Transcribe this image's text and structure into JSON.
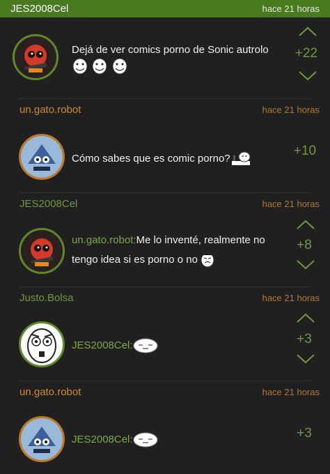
{
  "top": {
    "user": "JES2008Cel",
    "time": "hace 21 horas"
  },
  "comments": [
    {
      "user": "JES2008Cel",
      "time": "hace 21 horas",
      "text": "Dejá de ver comics porno de Sonic autrolo",
      "score": "+22",
      "mention": ""
    },
    {
      "user": "un.gato.robot",
      "time": "hace 21 horas",
      "text": "Cómo sabes que es comic porno?",
      "score": "+10",
      "mention": ""
    },
    {
      "user": "JES2008Cel",
      "time": "hace 21 horas",
      "mention": "un.gato.robot:",
      "text": "Me lo inventé, realmente no",
      "text2": "tengo idea si es porno o no",
      "score": "+8"
    },
    {
      "user": "Justo.Bolsa",
      "time": "hace 21 horas",
      "mention": "JES2008Cel:",
      "text": "",
      "score": "+3"
    },
    {
      "user": "un.gato.robot",
      "time": "hace 21 horas",
      "mention": "JES2008Cel:",
      "text": "",
      "score": "+3"
    }
  ],
  "colors": {
    "accent": "#4a7a1f",
    "score": "#6f9a40",
    "time": "#b07a2e",
    "username_orange": "#d08a2a",
    "username_green": "#6e9a3b"
  },
  "icons": [
    "up-arrow-icon",
    "down-arrow-icon",
    "troll-face-icon",
    "poker-face-icon",
    "yao-ming-face-icon"
  ]
}
